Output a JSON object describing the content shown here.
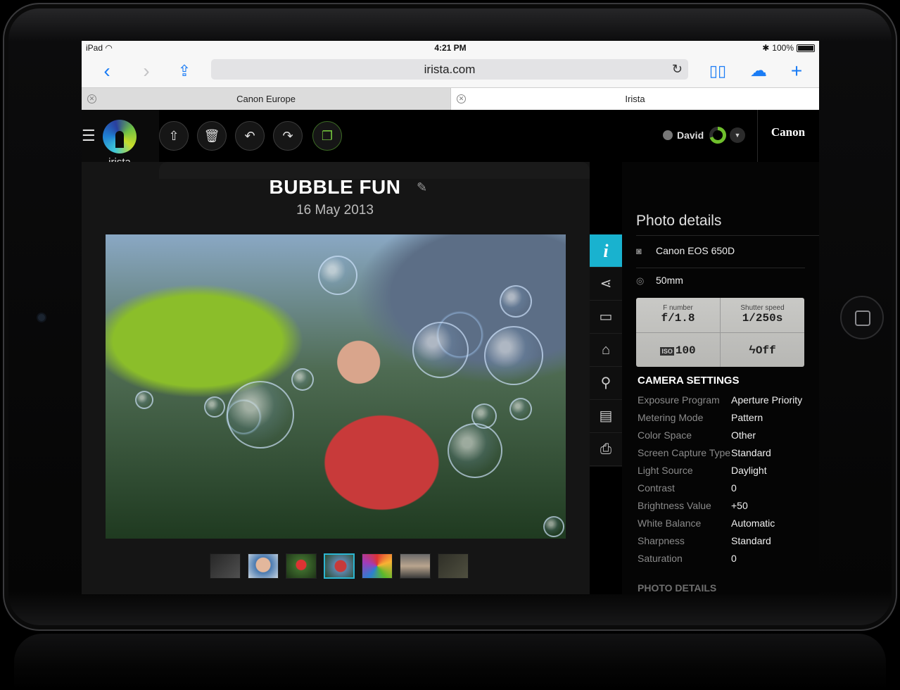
{
  "status": {
    "device": "iPad",
    "time": "4:21 PM",
    "battery": "100%"
  },
  "safari": {
    "url": "irista.com",
    "tabs": [
      {
        "label": "Canon Europe"
      },
      {
        "label": "Irista"
      }
    ]
  },
  "app": {
    "logo_text": "irista",
    "user_name": "David",
    "brand": "Canon",
    "photo": {
      "title": "BUBBLE FUN",
      "date": "16 May 2013"
    }
  },
  "panel": {
    "title": "Photo details",
    "camera": "Canon EOS 650D",
    "lens": "50mm",
    "exif": {
      "fnumber_label": "F number",
      "fnumber": "f/1.8",
      "shutter_label": "Shutter speed",
      "shutter": "1/250s",
      "iso_label": "ISO",
      "iso": "100",
      "flash": "Off"
    },
    "camera_settings_title": "CAMERA SETTINGS",
    "settings": [
      {
        "key": "Exposure Program",
        "value": "Aperture Priority"
      },
      {
        "key": "Metering Mode",
        "value": "Pattern"
      },
      {
        "key": "Color Space",
        "value": "Other"
      },
      {
        "key": "Screen Capture Type",
        "value": "Standard"
      },
      {
        "key": "Light Source",
        "value": "Daylight"
      },
      {
        "key": "Contrast",
        "value": "0"
      },
      {
        "key": "Brightness Value",
        "value": "+50"
      },
      {
        "key": "White Balance",
        "value": "Automatic"
      },
      {
        "key": "Sharpness",
        "value": "Standard"
      },
      {
        "key": "Saturation",
        "value": "0"
      }
    ],
    "photo_details_title": "PHOTO DETAILS"
  },
  "icons": {
    "upload": "cloud-upload-icon",
    "delete": "trash-icon",
    "undo": "undo-icon",
    "redo": "redo-icon",
    "copy": "copy-icon",
    "info": "info-icon",
    "share": "share-icon",
    "comments": "comments-icon",
    "tags": "tag-icon",
    "location": "location-icon",
    "album": "album-icon",
    "print": "print-icon"
  },
  "colors": {
    "accent": "#19b2cf",
    "green": "#73c43c",
    "background": "#000000"
  }
}
